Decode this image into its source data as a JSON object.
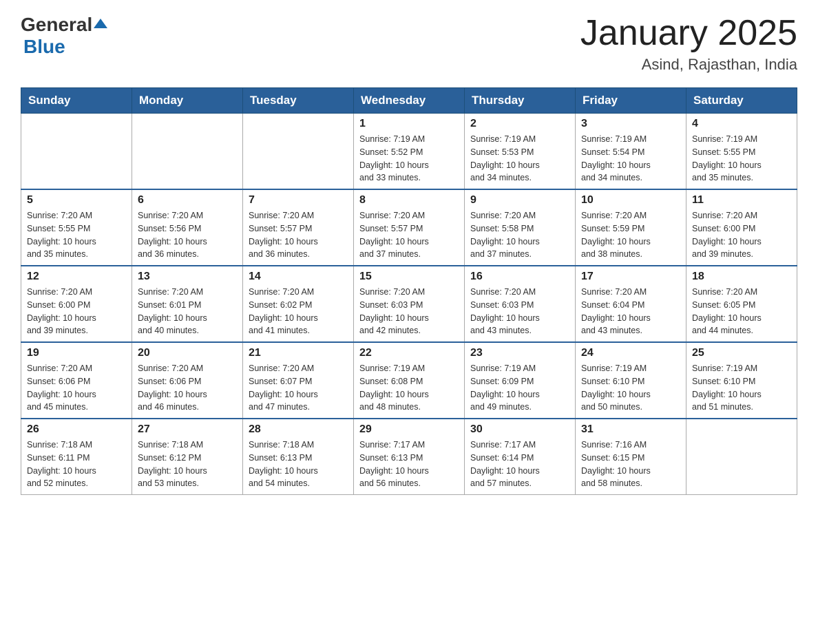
{
  "header": {
    "logo": {
      "general": "General",
      "blue": "Blue"
    },
    "title": "January 2025",
    "location": "Asind, Rajasthan, India"
  },
  "calendar": {
    "headers": [
      "Sunday",
      "Monday",
      "Tuesday",
      "Wednesday",
      "Thursday",
      "Friday",
      "Saturday"
    ],
    "weeks": [
      {
        "days": [
          {
            "date": "",
            "info": ""
          },
          {
            "date": "",
            "info": ""
          },
          {
            "date": "",
            "info": ""
          },
          {
            "date": "1",
            "info": "Sunrise: 7:19 AM\nSunset: 5:52 PM\nDaylight: 10 hours\nand 33 minutes."
          },
          {
            "date": "2",
            "info": "Sunrise: 7:19 AM\nSunset: 5:53 PM\nDaylight: 10 hours\nand 34 minutes."
          },
          {
            "date": "3",
            "info": "Sunrise: 7:19 AM\nSunset: 5:54 PM\nDaylight: 10 hours\nand 34 minutes."
          },
          {
            "date": "4",
            "info": "Sunrise: 7:19 AM\nSunset: 5:55 PM\nDaylight: 10 hours\nand 35 minutes."
          }
        ]
      },
      {
        "days": [
          {
            "date": "5",
            "info": "Sunrise: 7:20 AM\nSunset: 5:55 PM\nDaylight: 10 hours\nand 35 minutes."
          },
          {
            "date": "6",
            "info": "Sunrise: 7:20 AM\nSunset: 5:56 PM\nDaylight: 10 hours\nand 36 minutes."
          },
          {
            "date": "7",
            "info": "Sunrise: 7:20 AM\nSunset: 5:57 PM\nDaylight: 10 hours\nand 36 minutes."
          },
          {
            "date": "8",
            "info": "Sunrise: 7:20 AM\nSunset: 5:57 PM\nDaylight: 10 hours\nand 37 minutes."
          },
          {
            "date": "9",
            "info": "Sunrise: 7:20 AM\nSunset: 5:58 PM\nDaylight: 10 hours\nand 37 minutes."
          },
          {
            "date": "10",
            "info": "Sunrise: 7:20 AM\nSunset: 5:59 PM\nDaylight: 10 hours\nand 38 minutes."
          },
          {
            "date": "11",
            "info": "Sunrise: 7:20 AM\nSunset: 6:00 PM\nDaylight: 10 hours\nand 39 minutes."
          }
        ]
      },
      {
        "days": [
          {
            "date": "12",
            "info": "Sunrise: 7:20 AM\nSunset: 6:00 PM\nDaylight: 10 hours\nand 39 minutes."
          },
          {
            "date": "13",
            "info": "Sunrise: 7:20 AM\nSunset: 6:01 PM\nDaylight: 10 hours\nand 40 minutes."
          },
          {
            "date": "14",
            "info": "Sunrise: 7:20 AM\nSunset: 6:02 PM\nDaylight: 10 hours\nand 41 minutes."
          },
          {
            "date": "15",
            "info": "Sunrise: 7:20 AM\nSunset: 6:03 PM\nDaylight: 10 hours\nand 42 minutes."
          },
          {
            "date": "16",
            "info": "Sunrise: 7:20 AM\nSunset: 6:03 PM\nDaylight: 10 hours\nand 43 minutes."
          },
          {
            "date": "17",
            "info": "Sunrise: 7:20 AM\nSunset: 6:04 PM\nDaylight: 10 hours\nand 43 minutes."
          },
          {
            "date": "18",
            "info": "Sunrise: 7:20 AM\nSunset: 6:05 PM\nDaylight: 10 hours\nand 44 minutes."
          }
        ]
      },
      {
        "days": [
          {
            "date": "19",
            "info": "Sunrise: 7:20 AM\nSunset: 6:06 PM\nDaylight: 10 hours\nand 45 minutes."
          },
          {
            "date": "20",
            "info": "Sunrise: 7:20 AM\nSunset: 6:06 PM\nDaylight: 10 hours\nand 46 minutes."
          },
          {
            "date": "21",
            "info": "Sunrise: 7:20 AM\nSunset: 6:07 PM\nDaylight: 10 hours\nand 47 minutes."
          },
          {
            "date": "22",
            "info": "Sunrise: 7:19 AM\nSunset: 6:08 PM\nDaylight: 10 hours\nand 48 minutes."
          },
          {
            "date": "23",
            "info": "Sunrise: 7:19 AM\nSunset: 6:09 PM\nDaylight: 10 hours\nand 49 minutes."
          },
          {
            "date": "24",
            "info": "Sunrise: 7:19 AM\nSunset: 6:10 PM\nDaylight: 10 hours\nand 50 minutes."
          },
          {
            "date": "25",
            "info": "Sunrise: 7:19 AM\nSunset: 6:10 PM\nDaylight: 10 hours\nand 51 minutes."
          }
        ]
      },
      {
        "days": [
          {
            "date": "26",
            "info": "Sunrise: 7:18 AM\nSunset: 6:11 PM\nDaylight: 10 hours\nand 52 minutes."
          },
          {
            "date": "27",
            "info": "Sunrise: 7:18 AM\nSunset: 6:12 PM\nDaylight: 10 hours\nand 53 minutes."
          },
          {
            "date": "28",
            "info": "Sunrise: 7:18 AM\nSunset: 6:13 PM\nDaylight: 10 hours\nand 54 minutes."
          },
          {
            "date": "29",
            "info": "Sunrise: 7:17 AM\nSunset: 6:13 PM\nDaylight: 10 hours\nand 56 minutes."
          },
          {
            "date": "30",
            "info": "Sunrise: 7:17 AM\nSunset: 6:14 PM\nDaylight: 10 hours\nand 57 minutes."
          },
          {
            "date": "31",
            "info": "Sunrise: 7:16 AM\nSunset: 6:15 PM\nDaylight: 10 hours\nand 58 minutes."
          },
          {
            "date": "",
            "info": ""
          }
        ]
      }
    ]
  }
}
